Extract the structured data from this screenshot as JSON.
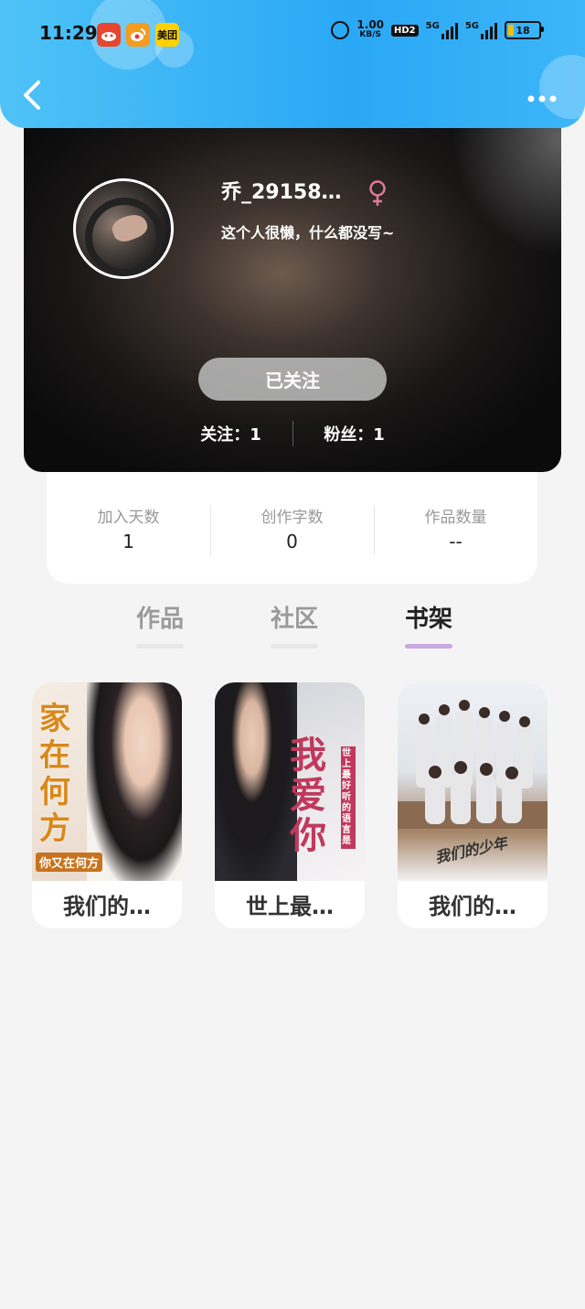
{
  "status_bar": {
    "time": "11:29",
    "app_icons": [
      {
        "name": "app-red-icon",
        "label": "",
        "color": "#e8452f"
      },
      {
        "name": "weibo-icon",
        "label": "",
        "color": "#f39c1d"
      },
      {
        "name": "meituan-icon",
        "label": "美团",
        "color": "#ffd100"
      }
    ],
    "speed_value": "1.00",
    "speed_unit": "KB/S",
    "hd_label": "HD2",
    "signal1_label": "5G",
    "signal2_label": "5G",
    "battery_level": "18"
  },
  "nav": {
    "back_icon": "chevron-left-icon",
    "more_icon": "more-horizontal-icon"
  },
  "profile": {
    "username": "乔_29158…",
    "gender_icon": "female-icon",
    "bio": "这个人很懒，什么都没写~",
    "follow_button_label": "已关注",
    "following_text": "关注：1",
    "followers_text": "粉丝：1"
  },
  "stats": [
    {
      "label": "加入天数",
      "value": "1"
    },
    {
      "label": "创作字数",
      "value": "0"
    },
    {
      "label": "作品数量",
      "value": "--"
    }
  ],
  "tabs": [
    {
      "label": "作品",
      "active": false
    },
    {
      "label": "社区",
      "active": false
    },
    {
      "label": "书架",
      "active": true
    }
  ],
  "books": [
    {
      "title": "我们的…",
      "cover_text": "家在何方",
      "cover_sub": "你又在何方"
    },
    {
      "title": "世上最…",
      "cover_text": "我爱你",
      "cover_sub": "世上最好听的语言是"
    },
    {
      "title": "我们的…",
      "cover_text": "我们的少年",
      "cover_sub": ""
    }
  ],
  "colors": {
    "header_gradient_start": "#4fc3f7",
    "header_gradient_end": "#2aa8f5",
    "tab_active_underline": "#c7a8e2",
    "female_icon_color": "#e07a9a",
    "page_background": "#f4f4f4"
  }
}
